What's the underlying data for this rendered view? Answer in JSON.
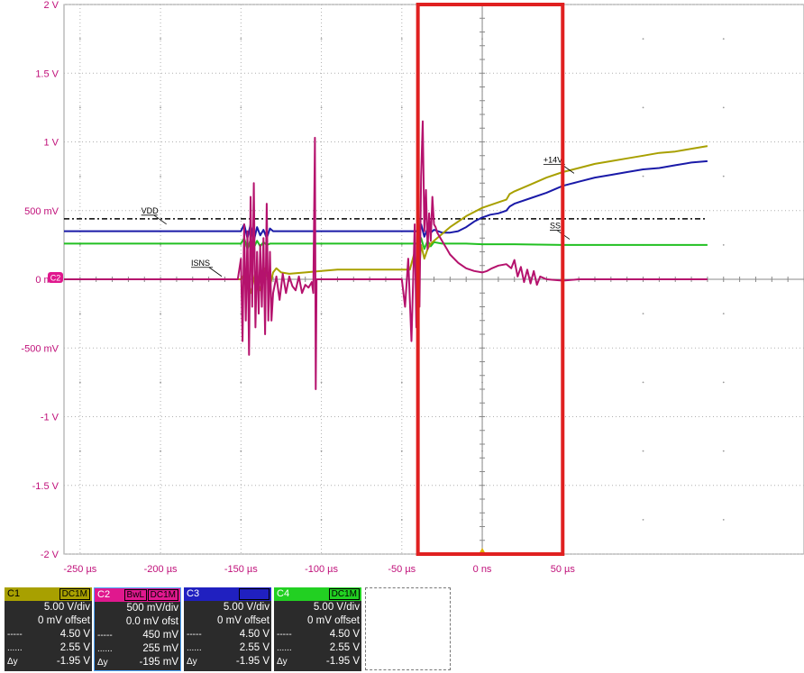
{
  "chart_data": {
    "type": "line",
    "title": "",
    "xlabel": "",
    "ylabel": "",
    "xlim": [
      -260,
      200
    ],
    "ylim": [
      -2,
      2
    ],
    "x_ticks": [
      "-250 µs",
      "-200 µs",
      "-150 µs",
      "-100 µs",
      "-50 µs",
      "0 ns",
      "50 µs"
    ],
    "x_tick_values": [
      -250,
      -200,
      -150,
      -100,
      -50,
      0,
      50
    ],
    "y_ticks": [
      "2 V",
      "1.5 V",
      "1 V",
      "500 mV",
      "0 mV",
      "-500 mV",
      "-1 V",
      "-1.5 V",
      "-2 V"
    ],
    "y_tick_values": [
      2,
      1.5,
      1,
      0.5,
      0,
      -0.5,
      -1,
      -1.5,
      -2
    ],
    "grid": true,
    "ground_marker": "C2",
    "trigger_level": 0.44,
    "highlight_box": {
      "x": [
        -40,
        50
      ],
      "y": [
        -2,
        2
      ],
      "color": "#e02020"
    },
    "series": [
      {
        "name": "VDD",
        "color": "#1a1aa8",
        "x": [
          -260,
          -150,
          -148,
          -146,
          -144,
          -142,
          -140,
          -138,
          -136,
          -134,
          -132,
          -130,
          -120,
          -60,
          -40,
          -38,
          -36,
          -34,
          -32,
          -30,
          -25,
          -20,
          -15,
          -10,
          -5,
          0,
          5,
          10,
          15,
          17,
          20,
          30,
          40,
          50,
          60,
          70,
          80,
          90,
          100,
          110,
          120,
          130,
          140
        ],
        "y": [
          0.35,
          0.35,
          0.4,
          0.3,
          0.4,
          0.28,
          0.38,
          0.32,
          0.36,
          0.3,
          0.37,
          0.35,
          0.35,
          0.35,
          0.35,
          0.4,
          0.31,
          0.37,
          0.34,
          0.36,
          0.34,
          0.34,
          0.35,
          0.38,
          0.42,
          0.45,
          0.47,
          0.48,
          0.5,
          0.53,
          0.55,
          0.59,
          0.63,
          0.68,
          0.71,
          0.74,
          0.76,
          0.78,
          0.8,
          0.81,
          0.83,
          0.85,
          0.86
        ]
      },
      {
        "name": "SS",
        "color": "#22c022",
        "x": [
          -260,
          -150,
          -148,
          -146,
          -144,
          -142,
          -140,
          -138,
          -136,
          -134,
          -132,
          -130,
          -60,
          -40,
          -38,
          -36,
          -34,
          -32,
          -30,
          -25,
          -20,
          -10,
          0,
          20,
          50,
          100,
          140
        ],
        "y": [
          0.26,
          0.26,
          0.3,
          0.22,
          0.29,
          0.23,
          0.28,
          0.24,
          0.27,
          0.25,
          0.26,
          0.26,
          0.26,
          0.26,
          0.3,
          0.22,
          0.28,
          0.24,
          0.27,
          0.26,
          0.26,
          0.26,
          0.255,
          0.255,
          0.25,
          0.25,
          0.25
        ]
      },
      {
        "name": "+14V",
        "color": "#a8a000",
        "x": [
          -260,
          -150,
          -147,
          -144,
          -141,
          -138,
          -135,
          -132,
          -130,
          -128,
          -125,
          -120,
          -110,
          -100,
          -90,
          -60,
          -45,
          -42,
          -40,
          -38,
          -36,
          -34,
          -32,
          -30,
          -25,
          -20,
          -10,
          0,
          10,
          15,
          17,
          20,
          30,
          40,
          50,
          60,
          70,
          80,
          90,
          100,
          110,
          120,
          130,
          140
        ],
        "y": [
          0,
          0,
          0.05,
          -0.1,
          0.05,
          -0.08,
          0.08,
          -0.05,
          0.05,
          0.08,
          0.05,
          0.04,
          0.05,
          0.06,
          0.07,
          0.07,
          0.07,
          0.2,
          -0.05,
          0.25,
          0.15,
          0.22,
          0.26,
          0.28,
          0.33,
          0.38,
          0.46,
          0.52,
          0.56,
          0.58,
          0.62,
          0.64,
          0.69,
          0.74,
          0.78,
          0.81,
          0.84,
          0.86,
          0.88,
          0.9,
          0.92,
          0.93,
          0.95,
          0.97
        ]
      },
      {
        "name": "ISNS",
        "color": "#b5126d",
        "x": [
          -260,
          -152,
          -150,
          -149,
          -148,
          -147,
          -146,
          -145,
          -144,
          -143,
          -142,
          -141,
          -140,
          -139,
          -138,
          -137,
          -136,
          -135,
          -134,
          -133,
          -132,
          -131,
          -130,
          -128,
          -126,
          -124,
          -122,
          -120,
          -118,
          -116,
          -114,
          -112,
          -110,
          -108,
          -106,
          -105,
          -104,
          -103.5,
          -103,
          -100,
          -60,
          -50,
          -48,
          -46,
          -44,
          -42,
          -41,
          -40,
          -39,
          -38,
          -37,
          -36,
          -35,
          -34,
          -33,
          -32,
          -31,
          -30,
          -29,
          -28,
          -26,
          -24,
          -22,
          -20,
          -15,
          -10,
          -5,
          0,
          3,
          6,
          10,
          15,
          18,
          20,
          22,
          24,
          26,
          28,
          30,
          32,
          34,
          36,
          40,
          50,
          60,
          80,
          100,
          140
        ],
        "y": [
          0,
          0,
          0.15,
          -0.45,
          0.4,
          -0.3,
          0.35,
          -0.55,
          0.6,
          -0.2,
          0.7,
          -0.35,
          0.2,
          -0.25,
          0.25,
          -0.2,
          0.3,
          -0.4,
          0.55,
          -0.3,
          0.2,
          -0.3,
          -0.1,
          0.02,
          -0.15,
          0.04,
          -0.1,
          0.02,
          -0.05,
          -0.08,
          0.02,
          -0.1,
          -0.04,
          -0.06,
          -0.02,
          -0.1,
          1.03,
          -0.8,
          0.0,
          0.0,
          0.0,
          0.0,
          -0.2,
          0.15,
          -0.45,
          0.4,
          -0.35,
          0.3,
          -0.2,
          0.75,
          1.15,
          0.35,
          0.65,
          0.22,
          0.48,
          0.28,
          0.6,
          0.4,
          0.38,
          0.34,
          0.3,
          0.26,
          0.22,
          0.18,
          0.12,
          0.08,
          0.06,
          0.05,
          0.06,
          0.08,
          0.1,
          0.11,
          0.08,
          0.14,
          0.02,
          0.09,
          -0.02,
          0.07,
          -0.03,
          0.06,
          -0.04,
          0.02,
          0.0,
          -0.01,
          0.0,
          0.0,
          0.0,
          0.0
        ]
      }
    ],
    "reference_lines": [
      {
        "y": 0.44,
        "style": "dashdot",
        "color": "#000000",
        "x": [
          -260,
          140
        ]
      }
    ],
    "trace_labels": [
      {
        "text": "VDD",
        "series": "VDD",
        "x": -212,
        "y": 0.48
      },
      {
        "text": "ISNS",
        "series": "ISNS",
        "x": -181,
        "y": 0.1
      },
      {
        "text": "+14V",
        "series": "+14V",
        "x": 38,
        "y": 0.85
      },
      {
        "text": "SS",
        "series": "SS",
        "x": 42,
        "y": 0.37
      }
    ]
  },
  "channels": [
    {
      "name": "C1",
      "color": "#a8a000",
      "bw": "",
      "coupling": "DC1M",
      "vdiv": "5.00 V/div",
      "offset": "0 mV offset",
      "l1": "4.50 V",
      "l2": "2.55 V",
      "dy": "-1.95 V"
    },
    {
      "name": "C2",
      "color": "#e0188e",
      "bw": "BwL",
      "coupling": "DC1M",
      "vdiv": "500 mV/div",
      "offset": "0.0 mV ofst",
      "l1": "450 mV",
      "l2": "255 mV",
      "dy": "-195 mV"
    },
    {
      "name": "C3",
      "color": "#2020c0",
      "bw": "",
      "coupling": "DC1M",
      "vdiv": "5.00 V/div",
      "offset": "0 mV offset",
      "l1": "4.50 V",
      "l2": "2.55 V",
      "dy": "-1.95 V"
    },
    {
      "name": "C4",
      "color": "#22d022",
      "bw": "",
      "coupling": "DC1M",
      "vdiv": "5.00 V/div",
      "offset": "0 mV offset",
      "l1": "4.50 V",
      "l2": "2.55 V",
      "dy": "-1.95 V"
    }
  ],
  "panel_symbols": {
    "dy_label": "Δy"
  }
}
